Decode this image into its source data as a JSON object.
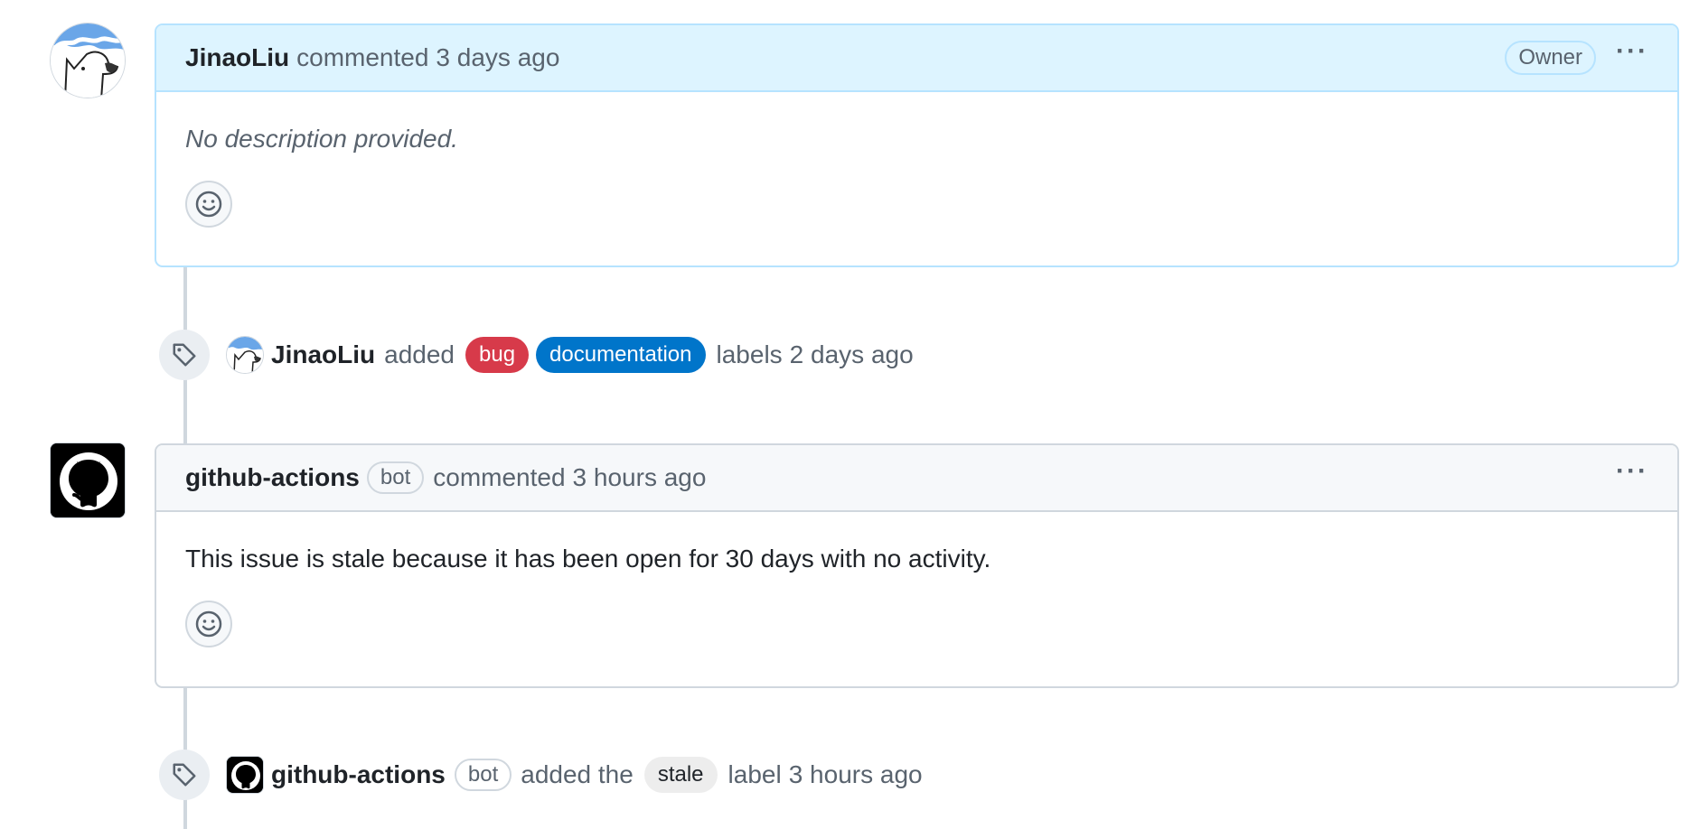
{
  "comments": [
    {
      "author": "JinaoLiu",
      "action": "commented",
      "time": "3 days ago",
      "role": "Owner",
      "body": "No description provided."
    },
    {
      "author": "github-actions",
      "bot_badge": "bot",
      "action": "commented",
      "time": "3 hours ago",
      "body": "This issue is stale because it has been open for 30 days with no activity."
    }
  ],
  "events": [
    {
      "author": "JinaoLiu",
      "action": "added",
      "labels": [
        {
          "name": "bug",
          "color": "#d73a4a",
          "text_color": "#ffffff"
        },
        {
          "name": "documentation",
          "color": "#0075ca",
          "text_color": "#ffffff"
        }
      ],
      "suffix": "labels",
      "time": "2 days ago"
    },
    {
      "author": "github-actions",
      "bot_badge": "bot",
      "action": "added the",
      "labels": [
        {
          "name": "stale",
          "color": "#ededed",
          "text_color": "#1f2328"
        }
      ],
      "suffix": "label",
      "time": "3 hours ago"
    }
  ],
  "icons": {
    "tag": "tag-icon",
    "smiley": "smiley-icon",
    "kebab": "kebab-horizontal-icon",
    "github": "github-mark-icon"
  },
  "colors": {
    "owner_header_bg": "#ddf4ff",
    "owner_border": "#b6e3ff",
    "plain_header_bg": "#f6f8fa",
    "border": "#d0d7de",
    "muted_text": "#59636e"
  }
}
